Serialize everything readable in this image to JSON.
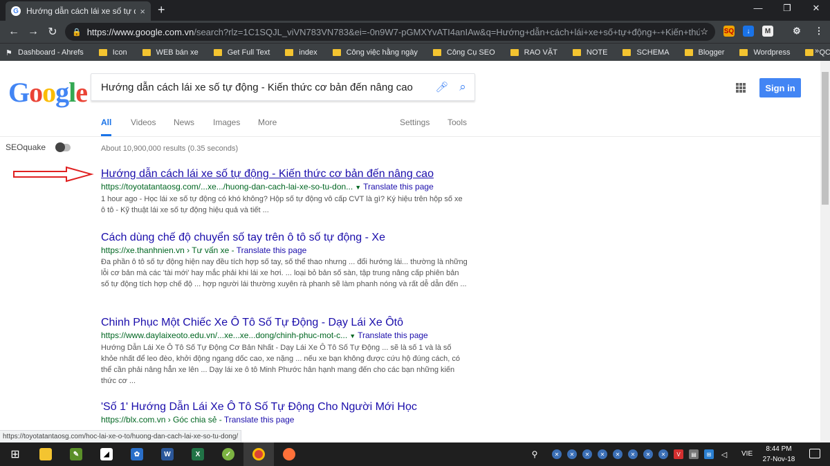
{
  "browser": {
    "tab_title": "Hướng dẫn cách lái xe số tự động - Kiến thức cơ bản đến nâng cao",
    "tab_close": "×",
    "new_tab": "+",
    "url_host": "https://www.google.com.vn",
    "url_path": "/search?rlz=1C1SQJL_viVN783VN783&ei=-0n9W7-pGMXYvATI4anIAw&q=Hướng+dẫn+cách+lái+xe+số+tự+động+-+Kiến+thức+c...",
    "bookmarks": [
      "Dashboard - Ahrefs",
      "Icon",
      "WEB bán xe",
      "Get Full Text",
      "index",
      "Công việc hằng ngày",
      "Công Cụ SEO",
      "RAO VẶT",
      "NOTE",
      "SCHEMA",
      "Blogger",
      "Wordpress",
      "QC adword"
    ],
    "bookmarks_more": "»",
    "status_url": "https://toyotatantaosg.com/hoc-lai-xe-o-to/huong-dan-cach-lai-xe-so-tu-dong/"
  },
  "google": {
    "logo": "Google",
    "query": "Hướng dẫn cách lái xe số tự động - Kiến thức cơ bản đến nâng cao",
    "signin": "Sign in",
    "tabs": [
      "All",
      "Videos",
      "News",
      "Images",
      "More"
    ],
    "tools": [
      "Settings",
      "Tools"
    ],
    "seoquake": "SEOquake",
    "stats": "About 10,900,000 results (0.35 seconds)",
    "results": [
      {
        "title": "Hướng dẫn cách lái xe số tự động - Kiến thức cơ bản đến nâng cao",
        "url": "https://toyotatantaosg.com/...xe.../huong-dan-cach-lai-xe-so-tu-don...",
        "translate": "Translate this page",
        "snippet": "1 hour ago - Học lái xe số tự động có khó không? Hộp số tự động vô cấp CVT là gì? Ký hiệu trên hộp số xe ô tô - Kỹ thuật lái xe số tự động hiệu quả và tiết ..."
      },
      {
        "title": "Cách dùng chế độ chuyển số tay trên ô tô số tự động - Xe",
        "url": "https://xe.thanhnien.vn › Tư vấn xe",
        "translate": "Translate this page",
        "snippet": "Đa phần ô tô số tự động hiện nay đều tích hợp số tay, số thể thao nhưng ... đổi hướng lái... thường là những lỗi cơ bản mà các 'tài mới' hay mắc phải khi lái xe hơi. ... loại bỏ bản số sàn, tập trung nâng cấp phiên bản số tự động tích hợp chế độ ... hợp người lái thường xuyên rà phanh sẽ làm phanh nóng và rất dễ dẫn đến ..."
      },
      {
        "title": "Chinh Phục Một Chiếc Xe Ô Tô Số Tự Động - Dạy Lái Xe Ôtô",
        "url": "https://www.daylaixeoto.edu.vn/...xe...xe...dong/chinh-phuc-mot-c...",
        "translate": "Translate this page",
        "snippet": "Hướng Dẫn Lái Xe Ô Tô Số Tự Động Cơ Bản Nhất - Dạy Lái Xe Ô Tô Số Tự Động ... sẽ là số 1 và là số khỏe nhất để leo đèo, khởi động ngang dốc cao, xe nặng ... nếu xe bạn không được cứu hộ đúng cách, có thể cần phải nâng hẳn xe lên ... Dạy lái xe ô tô Minh Phước hân hạnh mang đến cho các bạn những kiến thức cơ ..."
      },
      {
        "title": "'Số 1' Hướng Dẫn Lái Xe Ô Tô Số Tự Động Cho Người Mới Học",
        "url": "https://blx.com.vn › Góc chia sẻ",
        "translate": "Translate this page",
        "snippet": ""
      }
    ]
  },
  "taskbar": {
    "lang": "VIE",
    "time": "8:44 PM",
    "date": "27-Nov-18"
  }
}
